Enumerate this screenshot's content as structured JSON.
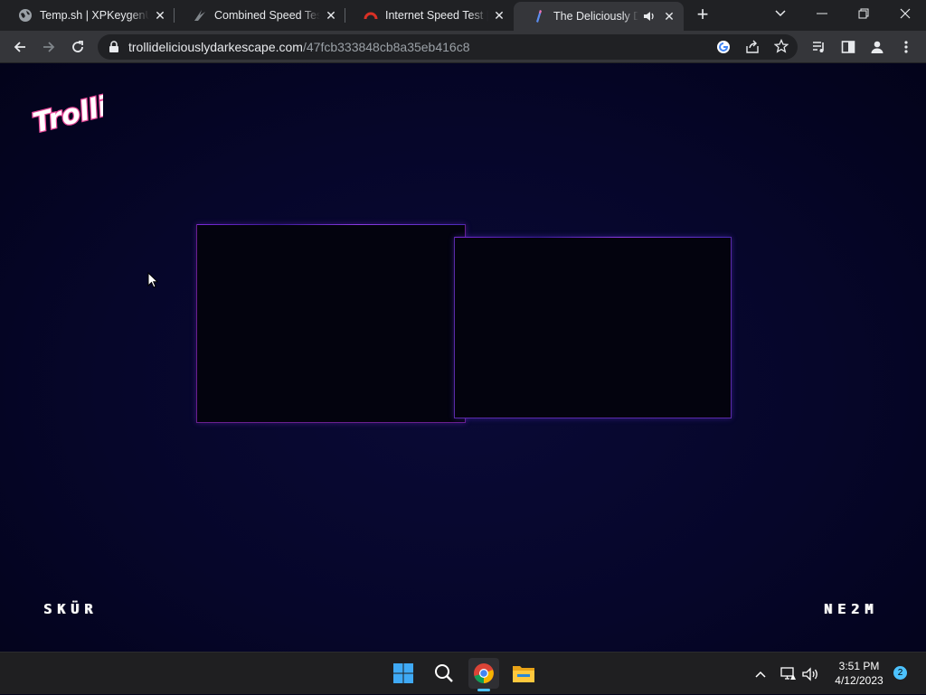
{
  "browser": {
    "tabs": [
      {
        "title": "Temp.sh | XPKeygenUl...",
        "favicon": "globe-icon"
      },
      {
        "title": "Combined Speed Test F...",
        "favicon": "speed-test-icon"
      },
      {
        "title": "Internet Speed Test | Fa...",
        "favicon": "speedometer-icon"
      },
      {
        "title": "The Deliciously Dar...",
        "favicon": "trolli-icon",
        "active": true,
        "audio": true
      }
    ],
    "new_tab_label": "+",
    "address": {
      "host": "trollideliciouslydarkescape.com",
      "path": "/47fcb333848cb8a35eb416c8"
    }
  },
  "page": {
    "logo_text": "Trolli",
    "skip_label": "SKÜR",
    "next_label": "NE2M"
  },
  "taskbar": {
    "time": "3:51 PM",
    "date": "4/12/2023",
    "notification_count": "2"
  },
  "colors": {
    "page_background": "#04041a",
    "panel_border_purple": "#6a1f8e",
    "panel_border_blue": "#5a2aa8",
    "accent_blue": "#4cc2ff"
  }
}
